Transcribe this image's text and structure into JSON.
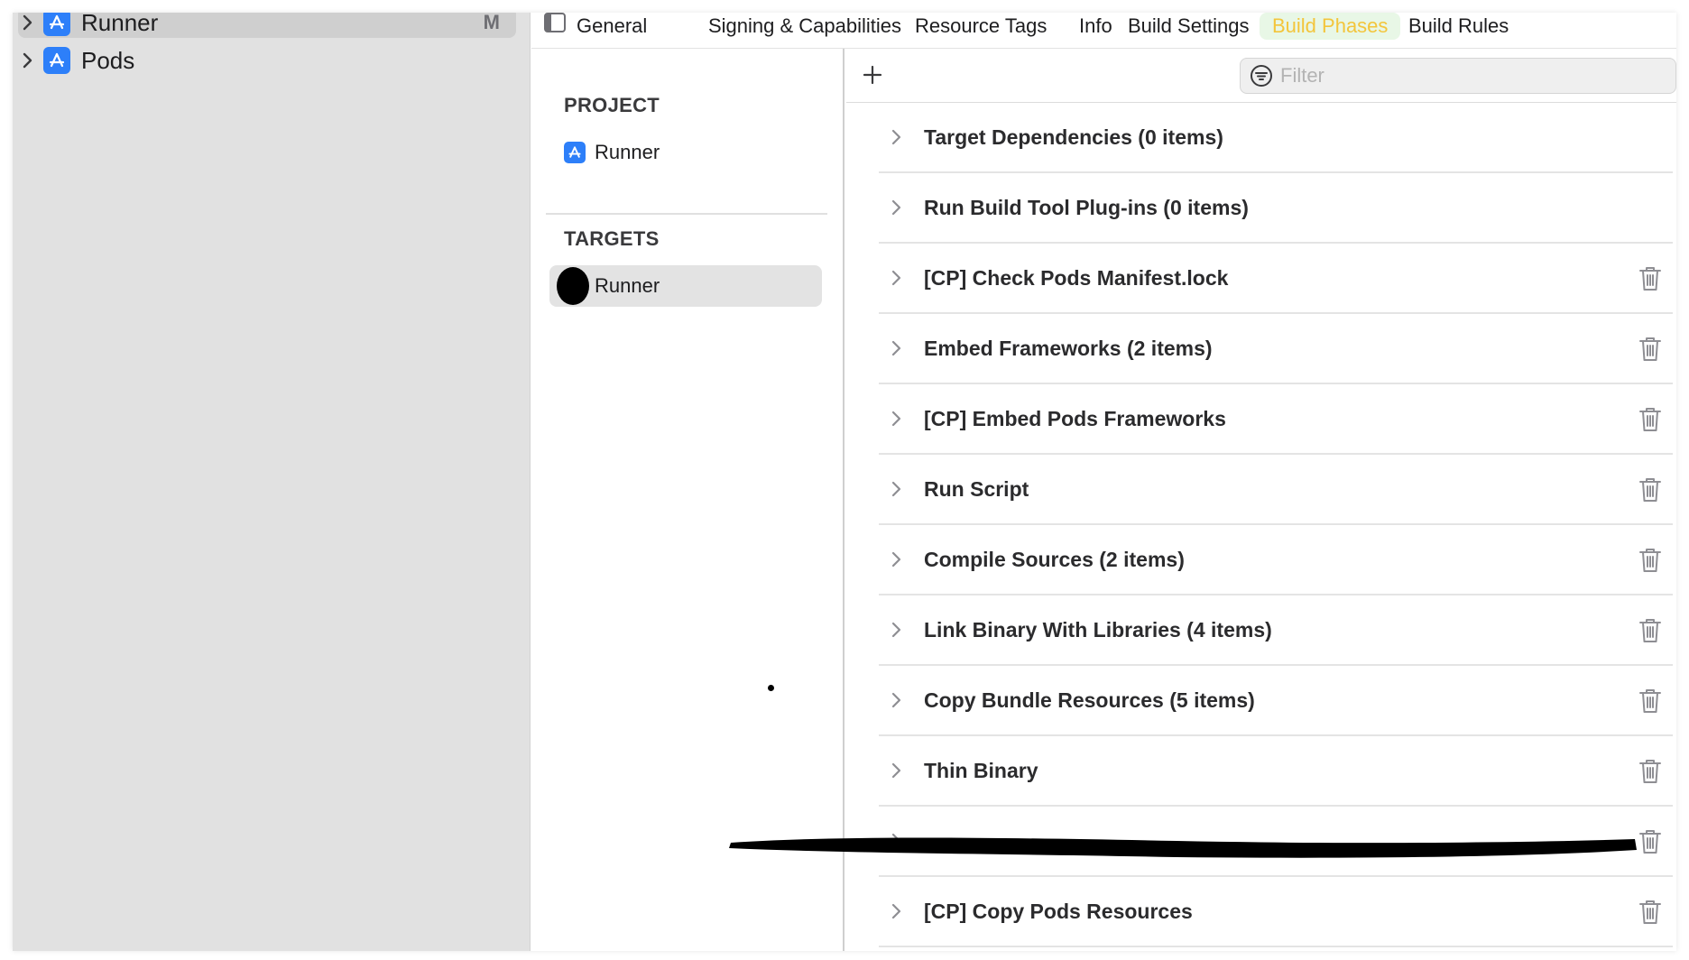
{
  "navigator": {
    "items": [
      {
        "label": "Runner",
        "badge": "M",
        "icon": "app-store-icon",
        "selected": true
      },
      {
        "label": "Pods",
        "icon": "app-store-icon",
        "selected": false
      }
    ]
  },
  "tabs": [
    {
      "label": "General"
    },
    {
      "label": "Signing & Capabilities"
    },
    {
      "label": "Resource Tags"
    },
    {
      "label": "Info"
    },
    {
      "label": "Build Settings"
    },
    {
      "label": "Build Phases",
      "active": true
    },
    {
      "label": "Build Rules"
    }
  ],
  "list": {
    "project_header": "PROJECT",
    "project_item": "Runner",
    "targets_header": "TARGETS",
    "target_item": "Runner"
  },
  "toolbar": {
    "add_icon": "plus-icon",
    "filter_placeholder": "Filter"
  },
  "phases": [
    {
      "label": "Target Dependencies (0 items)",
      "deletable": false
    },
    {
      "label": "Run Build Tool Plug-ins (0 items)",
      "deletable": false
    },
    {
      "label": "[CP] Check Pods Manifest.lock",
      "deletable": true
    },
    {
      "label": "Embed Frameworks (2 items)",
      "deletable": true
    },
    {
      "label": "[CP] Embed Pods Frameworks",
      "deletable": true
    },
    {
      "label": "Run Script",
      "deletable": true
    },
    {
      "label": "Compile Sources (2 items)",
      "deletable": true
    },
    {
      "label": "Link Binary With Libraries (4 items)",
      "deletable": true
    },
    {
      "label": "Copy Bundle Resources (5 items)",
      "deletable": true
    },
    {
      "label": "Thin Binary",
      "deletable": true
    },
    {
      "label": "",
      "deletable": true,
      "redacted": true
    },
    {
      "label": "[CP] Copy Pods Resources",
      "deletable": true
    }
  ],
  "colors": {
    "accent_tab_text": "#f3c53b",
    "accent_tab_bg": "#e8f7e6",
    "app_icon": "#2d7ff9"
  }
}
